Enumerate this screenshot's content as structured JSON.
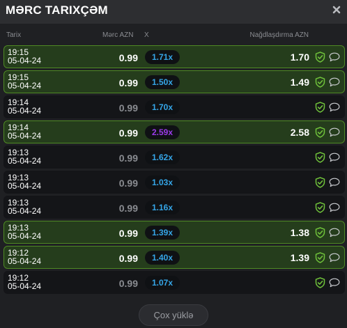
{
  "header": {
    "title": "MƏRC TARIXÇƏM"
  },
  "columns": {
    "date": "Tarix",
    "bet": "Mərc AZN",
    "mult": "X",
    "cash": "Nağdlaşdırma AZN"
  },
  "rows": [
    {
      "time": "19:15",
      "date": "05-04-24",
      "bet": "0.99",
      "mult": "1.71x",
      "cash": "1.70",
      "win": true,
      "mult_color": "blue"
    },
    {
      "time": "19:15",
      "date": "05-04-24",
      "bet": "0.99",
      "mult": "1.50x",
      "cash": "1.49",
      "win": true,
      "mult_color": "blue"
    },
    {
      "time": "19:14",
      "date": "05-04-24",
      "bet": "0.99",
      "mult": "1.70x",
      "cash": "",
      "win": false,
      "mult_color": "blue"
    },
    {
      "time": "19:14",
      "date": "05-04-24",
      "bet": "0.99",
      "mult": "2.59x",
      "cash": "2.58",
      "win": true,
      "mult_color": "purple"
    },
    {
      "time": "19:13",
      "date": "05-04-24",
      "bet": "0.99",
      "mult": "1.62x",
      "cash": "",
      "win": false,
      "mult_color": "blue"
    },
    {
      "time": "19:13",
      "date": "05-04-24",
      "bet": "0.99",
      "mult": "1.03x",
      "cash": "",
      "win": false,
      "mult_color": "blue"
    },
    {
      "time": "19:13",
      "date": "05-04-24",
      "bet": "0.99",
      "mult": "1.16x",
      "cash": "",
      "win": false,
      "mult_color": "blue"
    },
    {
      "time": "19:13",
      "date": "05-04-24",
      "bet": "0.99",
      "mult": "1.39x",
      "cash": "1.38",
      "win": true,
      "mult_color": "blue"
    },
    {
      "time": "19:12",
      "date": "05-04-24",
      "bet": "0.99",
      "mult": "1.40x",
      "cash": "1.39",
      "win": true,
      "mult_color": "blue"
    },
    {
      "time": "19:12",
      "date": "05-04-24",
      "bet": "0.99",
      "mult": "1.07x",
      "cash": "",
      "win": false,
      "mult_color": "blue"
    }
  ],
  "icons": {
    "close": "close-icon",
    "fair": "shield-check-icon",
    "chat": "chat-bubble-icon"
  },
  "colors": {
    "win_bg": "#253d1c",
    "win_border": "#4f8a24",
    "mult_blue": "#35a6e8",
    "mult_purple": "#9b3bea",
    "shield_green": "#6fc13a"
  },
  "footer": {
    "load_more": "Çox yüklə"
  }
}
